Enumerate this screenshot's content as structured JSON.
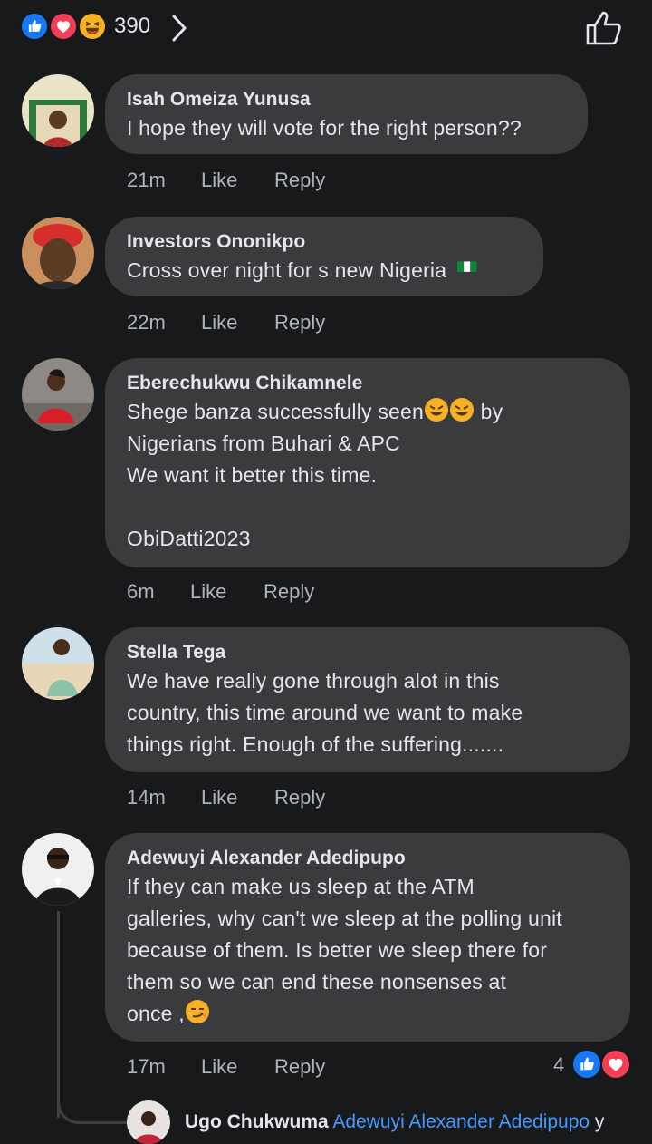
{
  "reactions": {
    "count": "390",
    "types": [
      "like-icon",
      "love-icon",
      "haha-icon"
    ],
    "colors": {
      "like": "#1877f2",
      "love": "#f33e58",
      "haha": "#f7b125"
    }
  },
  "comments": [
    {
      "name": "Isah Omeiza Yunusa",
      "text": "I hope they will vote for the right person??",
      "time": "21m",
      "like": "Like",
      "reply": "Reply"
    },
    {
      "name": "Investors  Ononikpo",
      "text": "Cross over night for s new Nigeria",
      "time": "22m",
      "like": "Like",
      "reply": "Reply"
    },
    {
      "name": "Eberechukwu Chikamnele",
      "text_line1_a": "Shege banza successfully seen",
      "text_line1_b": " by",
      "text_rest": "Nigerians from Buhari & APC\nWe want it better this time.\n\nObiDatti2023",
      "time": "6m",
      "like": "Like",
      "reply": "Reply"
    },
    {
      "name": "Stella Tega",
      "text": "We have really gone through alot in this\ncountry, this time around we want to make\nthings right.  Enough of the suffering.......",
      "time": "14m",
      "like": "Like",
      "reply": "Reply"
    },
    {
      "name": "Adewuyi Alexander Adedipupo",
      "text_main": "If they can make us sleep at the ATM\ngalleries, why can't we sleep at the polling unit\nbecause of them. Is better we sleep there for\nthem so we can end these nonsenses at\nonce ,",
      "time": "17m",
      "like": "Like",
      "reply": "Reply",
      "reaction_count": "4"
    }
  ],
  "reply_preview": {
    "name": "Ugo Chukwuma",
    "tag": "Adewuyi Alexander Adedipupo",
    "trail": " y"
  }
}
